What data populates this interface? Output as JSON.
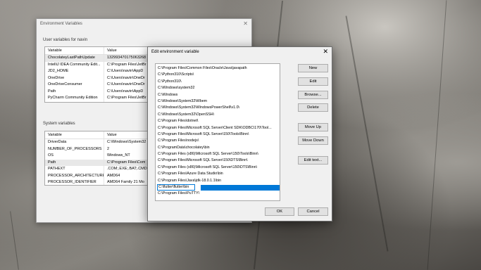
{
  "env_window": {
    "title": "Environment Variables",
    "close_glyph": "✕",
    "user_section_label": "User variables for navin",
    "system_section_label": "System variables",
    "column_variable": "Variable",
    "column_value": "Value",
    "user_rows": [
      {
        "name": "ChocolateyLastPathUpdate",
        "value": "132993470175063268"
      },
      {
        "name": "IntelliJ IDEA Community Edit...",
        "value": "C:\\Program Files\\JetBr"
      },
      {
        "name": "JD2_HOME",
        "value": "C:\\Users\\navin\\AppD"
      },
      {
        "name": "OneDrive",
        "value": "C:\\Users\\navin\\OneDr"
      },
      {
        "name": "OneDriveConsumer",
        "value": "C:\\Users\\navin\\OneDr"
      },
      {
        "name": "Path",
        "value": "C:\\Users\\navin\\AppD"
      },
      {
        "name": "PyCharm Community Edition",
        "value": "C:\\Program Files\\JetBr"
      }
    ],
    "system_rows": [
      {
        "name": "DriverData",
        "value": "C:\\Windows\\System32"
      },
      {
        "name": "NUMBER_OF_PROCESSORS",
        "value": "2"
      },
      {
        "name": "OS",
        "value": "Windows_NT"
      },
      {
        "name": "Path",
        "value": "C:\\Program Files\\Com"
      },
      {
        "name": "PATHEXT",
        "value": ".COM;.EXE;.BAT;.CMD;"
      },
      {
        "name": "PROCESSOR_ARCHITECTURE",
        "value": "AMD64"
      },
      {
        "name": "PROCESSOR_IDENTIFIER",
        "value": "AMD64 Family 21 Mo"
      }
    ]
  },
  "edit_dialog": {
    "title": "Edit environment variable",
    "close_glyph": "✕",
    "paths": [
      "C:\\Program Files\\Common Files\\Oracle\\Java\\javapath",
      "C:\\Python310\\Scripts\\",
      "C:\\Python310\\",
      "C:\\Windows\\system32",
      "C:\\Windows",
      "C:\\Windows\\System32\\Wbem",
      "C:\\Windows\\System32\\WindowsPowerShell\\v1.0\\",
      "C:\\Windows\\System32\\OpenSSH\\",
      "C:\\Program Files\\dotnet\\",
      "C:\\Program Files\\Microsoft SQL Server\\Client SDK\\ODBC\\170\\Tool...",
      "C:\\Program Files\\Microsoft SQL Server\\150\\Tools\\Binn\\",
      "C:\\Program Files\\nodejs\\",
      "C:\\ProgramData\\chocolatey\\bin",
      "C:\\Program Files (x86)\\Microsoft SQL Server\\150\\Tools\\Binn\\",
      "C:\\Program Files\\Microsoft SQL Server\\150\\DTS\\Binn\\",
      "C:\\Program Files (x86)\\Microsoft SQL Server\\150\\DTS\\Binn\\",
      "C:\\Program Files\\Azure Data Studio\\bin",
      "C:\\Program Files\\Java\\jdk-18.0.1.1\\bin"
    ],
    "editing_value": "C:\\flutter\\flutter\\bin",
    "last_path": "C:\\Program Files\\PuTTY\\",
    "buttons": {
      "new": "New",
      "edit": "Edit",
      "browse": "Browse...",
      "delete": "Delete",
      "move_up": "Move Up",
      "move_down": "Move Down",
      "edit_text": "Edit text...",
      "ok": "OK",
      "cancel": "Cancel"
    },
    "accent_color": "#0078d7"
  }
}
